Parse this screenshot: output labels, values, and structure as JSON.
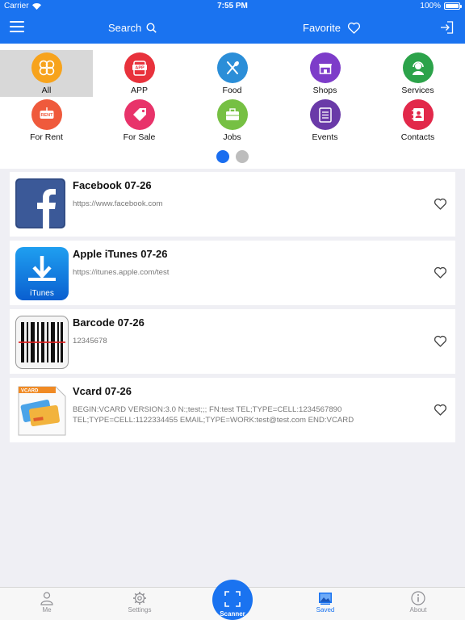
{
  "status": {
    "carrier": "Carrier",
    "time": "7:55 PM",
    "battery": "100%"
  },
  "nav": {
    "search_label": "Search",
    "favorite_label": "Favorite"
  },
  "categories": [
    {
      "label": "All",
      "color": "#f7a31c",
      "icon": "clover-icon"
    },
    {
      "label": "APP",
      "color": "#e8323c",
      "icon": "app-icon"
    },
    {
      "label": "Food",
      "color": "#2b8ed8",
      "icon": "utensils-icon"
    },
    {
      "label": "Shops",
      "color": "#7d3cc9",
      "icon": "shop-icon"
    },
    {
      "label": "Services",
      "color": "#2ca34a",
      "icon": "headset-icon"
    },
    {
      "label": "For Rent",
      "color": "#ef5a3c",
      "icon": "rent-sign-icon"
    },
    {
      "label": "For Sale",
      "color": "#e8336a",
      "icon": "price-tag-icon"
    },
    {
      "label": "Jobs",
      "color": "#76c043",
      "icon": "briefcase-icon"
    },
    {
      "label": "Events",
      "color": "#6a3aa8",
      "icon": "clipboard-icon"
    },
    {
      "label": "Contacts",
      "color": "#e2284a",
      "icon": "address-book-icon"
    }
  ],
  "page_dots": {
    "active_color": "#1a6ef0",
    "inactive_color": "#bdbdbd"
  },
  "items": [
    {
      "title": "Facebook 07-26",
      "subtitle": "https://www.facebook.com",
      "icon": "facebook-icon"
    },
    {
      "title": "Apple iTunes 07-26",
      "subtitle": "https://itunes.apple.com/test",
      "icon": "itunes-icon",
      "icon_text": "iTunes"
    },
    {
      "title": "Barcode 07-26",
      "subtitle": "12345678",
      "icon": "barcode-icon"
    },
    {
      "title": "Vcard 07-26",
      "subtitle": "BEGIN:VCARD VERSION:3.0 N:;test;;; FN:test TEL;TYPE=CELL:1234567890 TEL;TYPE=CELL:1122334455 EMAIL;TYPE=WORK:test@test.com END:VCARD",
      "icon": "vcard-icon",
      "icon_text": "VCARD"
    }
  ],
  "tabs": {
    "me": "Me",
    "settings": "Settings",
    "scanner": "Scanner",
    "saved": "Saved",
    "about": "About"
  },
  "colors": {
    "accent": "#1a73f0",
    "background": "#efeff4"
  }
}
